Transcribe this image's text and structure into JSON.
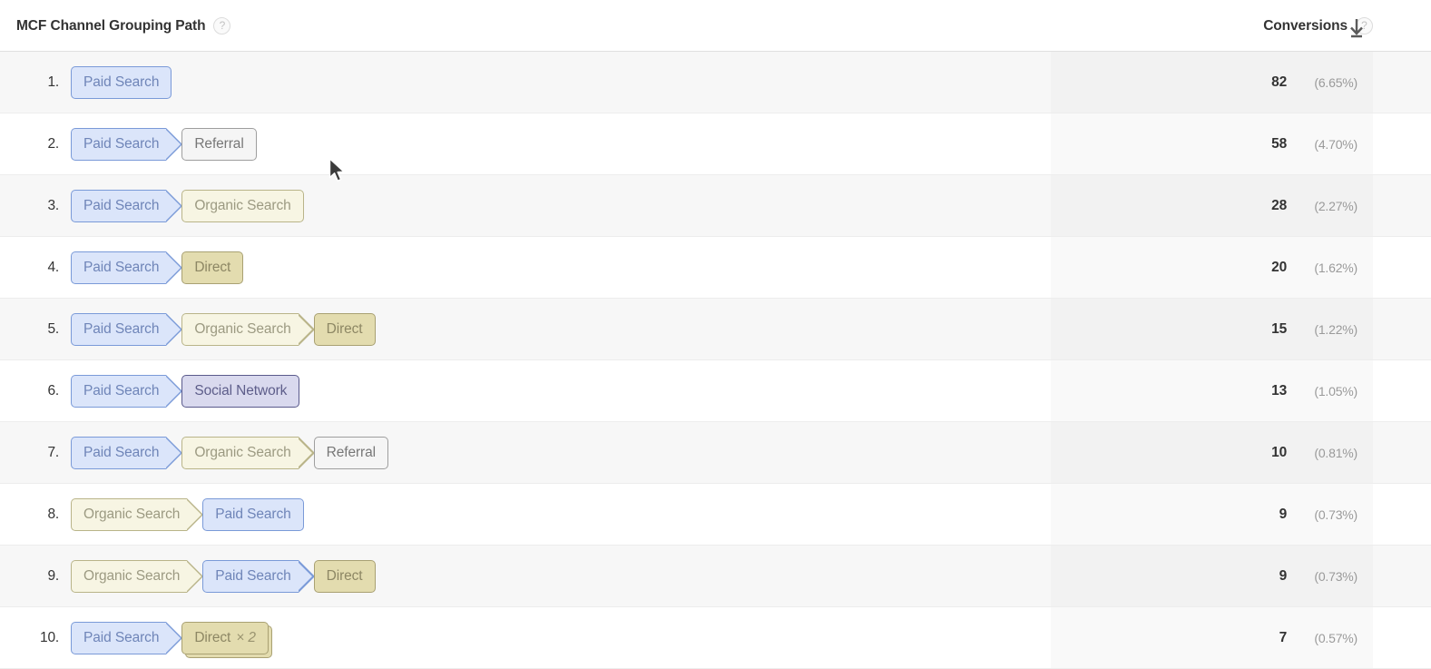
{
  "table": {
    "dimension_header": "MCF Channel Grouping Path",
    "metric_header": "Conversions",
    "help_icon_glyph": "?",
    "sort_direction": "descending",
    "sort_icon": "down-arrow"
  },
  "channel_colors": {
    "paid_search": "#dbe5fa",
    "organic_search": "#f7f5e3",
    "direct": "#e3dcaf",
    "referral": "#f5f5f5",
    "social_network": "#d9d9ee"
  },
  "rows": [
    {
      "index": "1.",
      "path": [
        {
          "label": "Paid Search",
          "channel": "paid"
        }
      ],
      "conversions": "82",
      "percent": "(6.65%)"
    },
    {
      "index": "2.",
      "path": [
        {
          "label": "Paid Search",
          "channel": "paid"
        },
        {
          "label": "Referral",
          "channel": "referral"
        }
      ],
      "conversions": "58",
      "percent": "(4.70%)"
    },
    {
      "index": "3.",
      "path": [
        {
          "label": "Paid Search",
          "channel": "paid"
        },
        {
          "label": "Organic Search",
          "channel": "organic"
        }
      ],
      "conversions": "28",
      "percent": "(2.27%)"
    },
    {
      "index": "4.",
      "path": [
        {
          "label": "Paid Search",
          "channel": "paid"
        },
        {
          "label": "Direct",
          "channel": "direct"
        }
      ],
      "conversions": "20",
      "percent": "(1.62%)"
    },
    {
      "index": "5.",
      "path": [
        {
          "label": "Paid Search",
          "channel": "paid"
        },
        {
          "label": "Organic Search",
          "channel": "organic"
        },
        {
          "label": "Direct",
          "channel": "direct"
        }
      ],
      "conversions": "15",
      "percent": "(1.22%)"
    },
    {
      "index": "6.",
      "path": [
        {
          "label": "Paid Search",
          "channel": "paid"
        },
        {
          "label": "Social Network",
          "channel": "social"
        }
      ],
      "conversions": "13",
      "percent": "(1.05%)"
    },
    {
      "index": "7.",
      "path": [
        {
          "label": "Paid Search",
          "channel": "paid"
        },
        {
          "label": "Organic Search",
          "channel": "organic"
        },
        {
          "label": "Referral",
          "channel": "referral"
        }
      ],
      "conversions": "10",
      "percent": "(0.81%)"
    },
    {
      "index": "8.",
      "path": [
        {
          "label": "Organic Search",
          "channel": "organic"
        },
        {
          "label": "Paid Search",
          "channel": "paid"
        }
      ],
      "conversions": "9",
      "percent": "(0.73%)"
    },
    {
      "index": "9.",
      "path": [
        {
          "label": "Organic Search",
          "channel": "organic"
        },
        {
          "label": "Paid Search",
          "channel": "paid"
        },
        {
          "label": "Direct",
          "channel": "direct"
        }
      ],
      "conversions": "9",
      "percent": "(0.73%)"
    },
    {
      "index": "10.",
      "path": [
        {
          "label": "Paid Search",
          "channel": "paid"
        },
        {
          "label": "Direct",
          "channel": "direct",
          "multiplier": "× 2"
        }
      ],
      "conversions": "7",
      "percent": "(0.57%)"
    }
  ]
}
